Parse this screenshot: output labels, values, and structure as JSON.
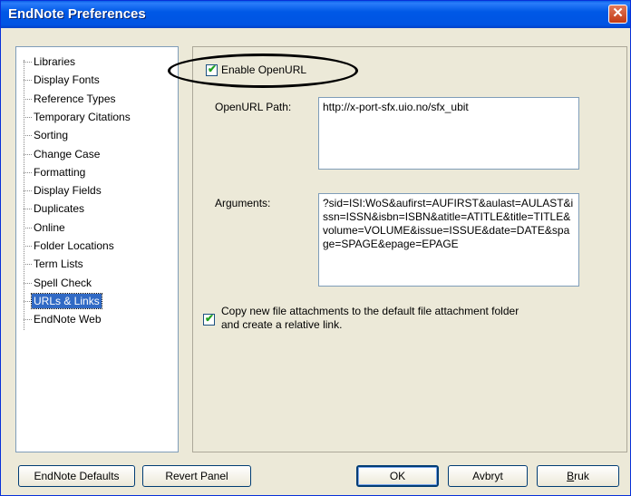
{
  "window": {
    "title": "EndNote Preferences",
    "close_glyph": "✕"
  },
  "sidebar": {
    "items": [
      {
        "label": "Libraries"
      },
      {
        "label": "Display Fonts"
      },
      {
        "label": "Reference Types"
      },
      {
        "label": "Temporary Citations"
      },
      {
        "label": "Sorting"
      },
      {
        "label": "Change Case"
      },
      {
        "label": "Formatting"
      },
      {
        "label": "Display Fields"
      },
      {
        "label": "Duplicates"
      },
      {
        "label": "Online"
      },
      {
        "label": "Folder Locations"
      },
      {
        "label": "Term Lists"
      },
      {
        "label": "Spell Check"
      },
      {
        "label": "URLs & Links",
        "selected": true
      },
      {
        "label": "EndNote Web"
      }
    ]
  },
  "panel": {
    "enable_openurl": {
      "label": "Enable OpenURL",
      "checked": true
    },
    "openurl_path": {
      "label": "OpenURL Path:",
      "value": "http://x-port-sfx.uio.no/sfx_ubit"
    },
    "arguments": {
      "label": "Arguments:",
      "value": "?sid=ISI:WoS&aufirst=AUFIRST&aulast=AULAST&issn=ISSN&isbn=ISBN&atitle=ATITLE&title=TITLE&volume=VOLUME&issue=ISSUE&date=DATE&spage=SPAGE&epage=EPAGE"
    },
    "copy_attachments": {
      "label_line1": "Copy new file attachments to the default file attachment folder",
      "label_line2": "and create a relative link.",
      "checked": true
    }
  },
  "buttons": {
    "endnote_defaults": "EndNote Defaults",
    "revert_panel": "Revert Panel",
    "ok": "OK",
    "cancel": "Avbryt",
    "apply_prefix": "B",
    "apply_rest": "ruk"
  },
  "colors": {
    "titlebar": "#0054e3",
    "selection": "#316ac5",
    "window_bg": "#ece9d8"
  },
  "icons": {
    "close": "close-icon",
    "check": "checkmark-icon"
  }
}
